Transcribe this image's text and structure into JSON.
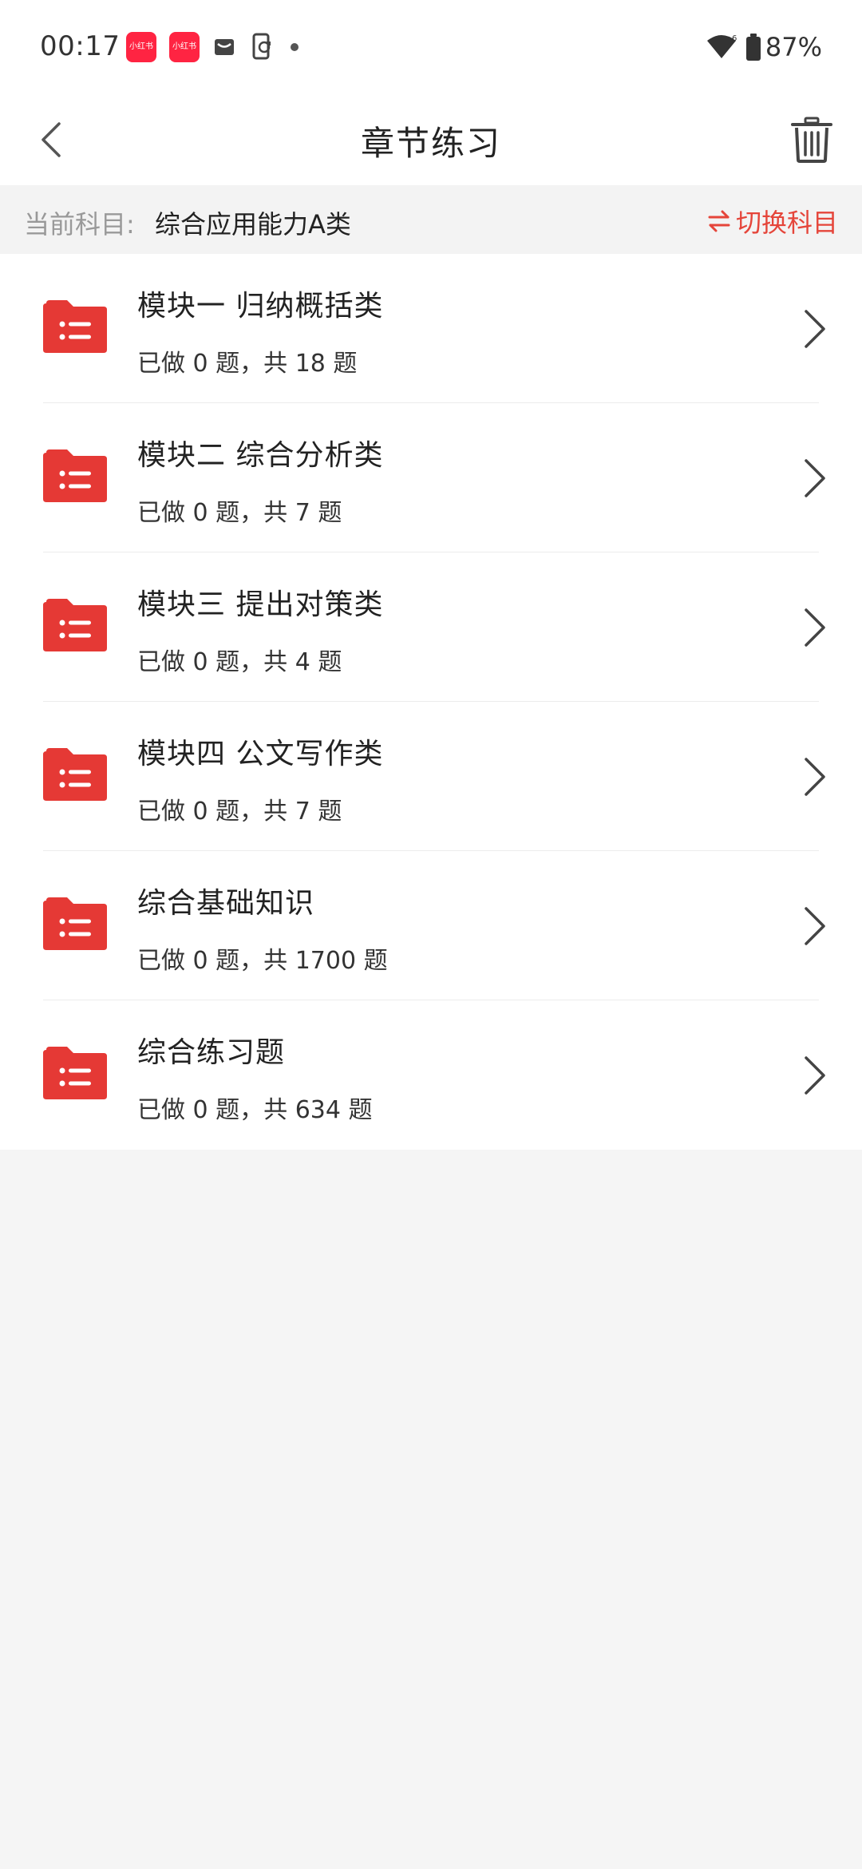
{
  "status_bar": {
    "time": "00:17",
    "app_badge_1": "小红书",
    "app_badge_2": "小红书",
    "battery": "87%"
  },
  "header": {
    "title": "章节练习"
  },
  "subject": {
    "label": "当前科目:",
    "value": "综合应用能力A类",
    "switch_label": "切换科目"
  },
  "colors": {
    "accent": "#e5453a",
    "folder": "#e53935"
  },
  "chapters": [
    {
      "title": "模块一 归纳概括类",
      "progress": "已做 0 题，共 18 题"
    },
    {
      "title": "模块二 综合分析类",
      "progress": "已做 0 题，共 7 题"
    },
    {
      "title": "模块三 提出对策类",
      "progress": "已做 0 题，共 4 题"
    },
    {
      "title": "模块四 公文写作类",
      "progress": "已做 0 题，共 7 题"
    },
    {
      "title": "综合基础知识",
      "progress": "已做 0 题，共 1700 题"
    },
    {
      "title": "综合练习题",
      "progress": "已做 0 题，共 634 题"
    }
  ]
}
